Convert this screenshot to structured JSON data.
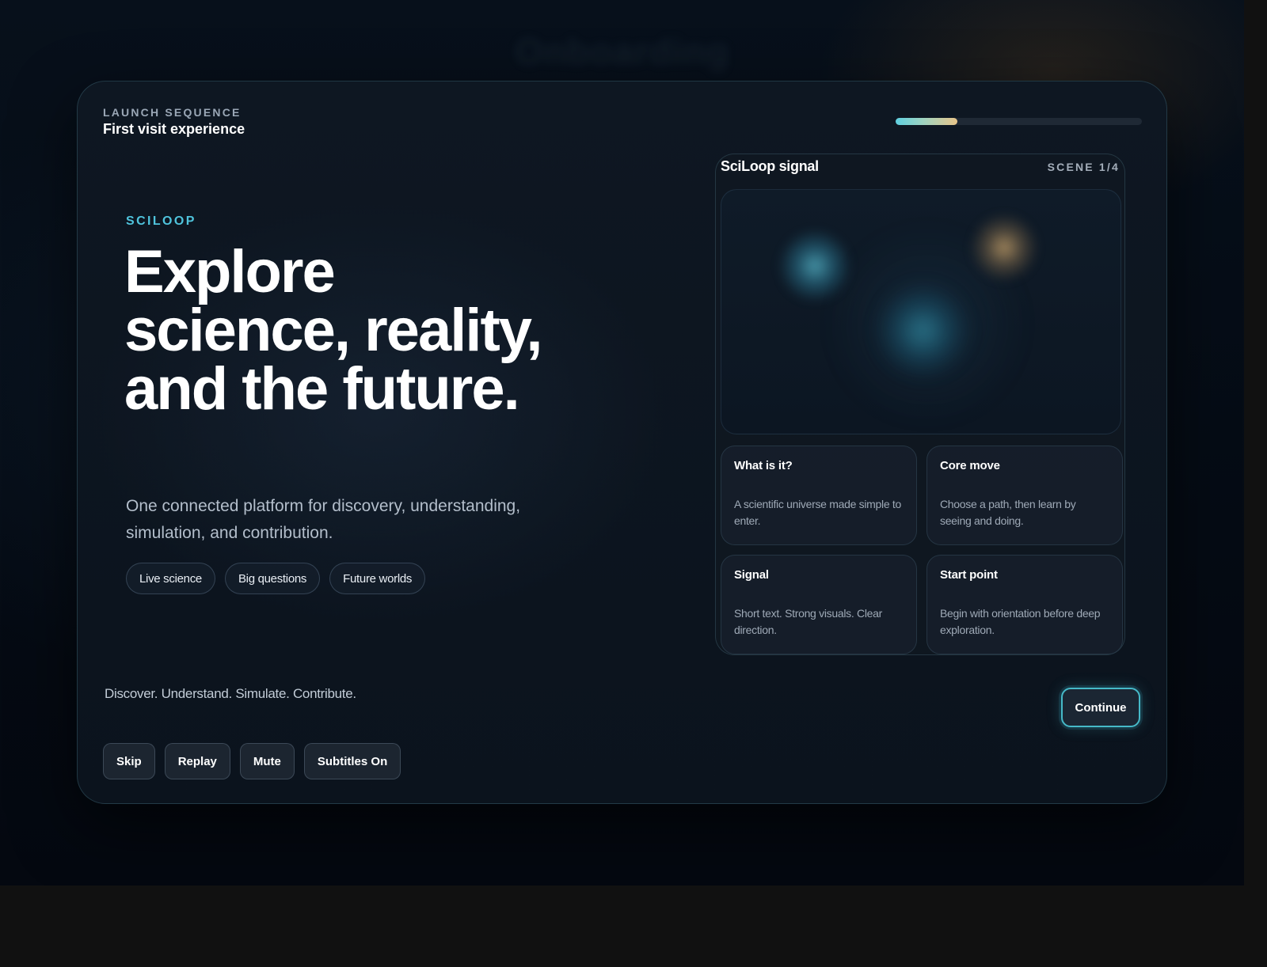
{
  "background_title": "Onboarding",
  "header": {
    "eyebrow": "LAUNCH SEQUENCE",
    "subtitle": "First visit experience",
    "progress_fraction": 0.25
  },
  "hero": {
    "brand": "SCILOOP",
    "headline": "Explore science, reality, and the future.",
    "lede": "One connected platform for discovery, understanding, simulation, and contribution.",
    "chips": [
      "Live science",
      "Big questions",
      "Future worlds"
    ]
  },
  "panel": {
    "title": "SciLoop signal",
    "scene": "SCENE 1/4",
    "tiles": [
      {
        "title": "What is it?",
        "body": "A scientific universe made simple to enter."
      },
      {
        "title": "Core move",
        "body": "Choose a path, then learn by seeing and doing."
      },
      {
        "title": "Signal",
        "body": "Short text. Strong visuals. Clear direction."
      },
      {
        "title": "Start point",
        "body": "Begin with orientation before deep exploration."
      }
    ]
  },
  "footer": {
    "tagline": "Discover. Understand. Simulate. Contribute.",
    "continue_label": "Continue",
    "controls": [
      "Skip",
      "Replay",
      "Mute",
      "Subtitles On"
    ]
  },
  "colors": {
    "accent_cyan": "#4fc3dc",
    "accent_gold": "#e8c58a",
    "card_bg": "#0e1722"
  }
}
